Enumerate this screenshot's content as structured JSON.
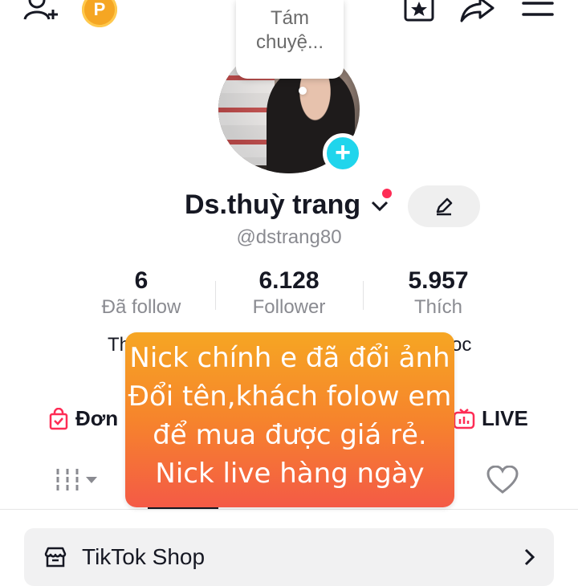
{
  "topbar": {
    "add_friend_icon": "person-plus-icon",
    "coin_label": "P",
    "favorites_icon": "star-box-icon",
    "share_icon": "share-arrow-icon",
    "menu_icon": "hamburger-menu-icon"
  },
  "profile": {
    "bubble_text_1": "Tám",
    "bubble_text_2": "chuyệ...",
    "name": "Ds.thuỳ trang",
    "handle": "@dstrang80"
  },
  "stats": [
    {
      "value": "6",
      "label": "Đã follow"
    },
    {
      "value": "6.128",
      "label": "Follower"
    },
    {
      "value": "5.957",
      "label": "Thích"
    }
  ],
  "bio": {
    "left_fragment": "Th",
    "right_fragment": "oc"
  },
  "links": {
    "orders_label": "Đơn hà",
    "live_label": "LIVE"
  },
  "overlay": {
    "lines": [
      "Nick chính e đã đổi ảnh",
      "Đổi tên,khách folow em",
      "để mua được giá rẻ.",
      "Nick live hàng ngày"
    ]
  },
  "shop": {
    "label": "TikTok Shop"
  },
  "colors": {
    "accent_cyan": "#20d5ec",
    "notification_red": "#fe2c55",
    "overlay_top": "#f6a623",
    "overlay_bottom": "#f45a46"
  }
}
